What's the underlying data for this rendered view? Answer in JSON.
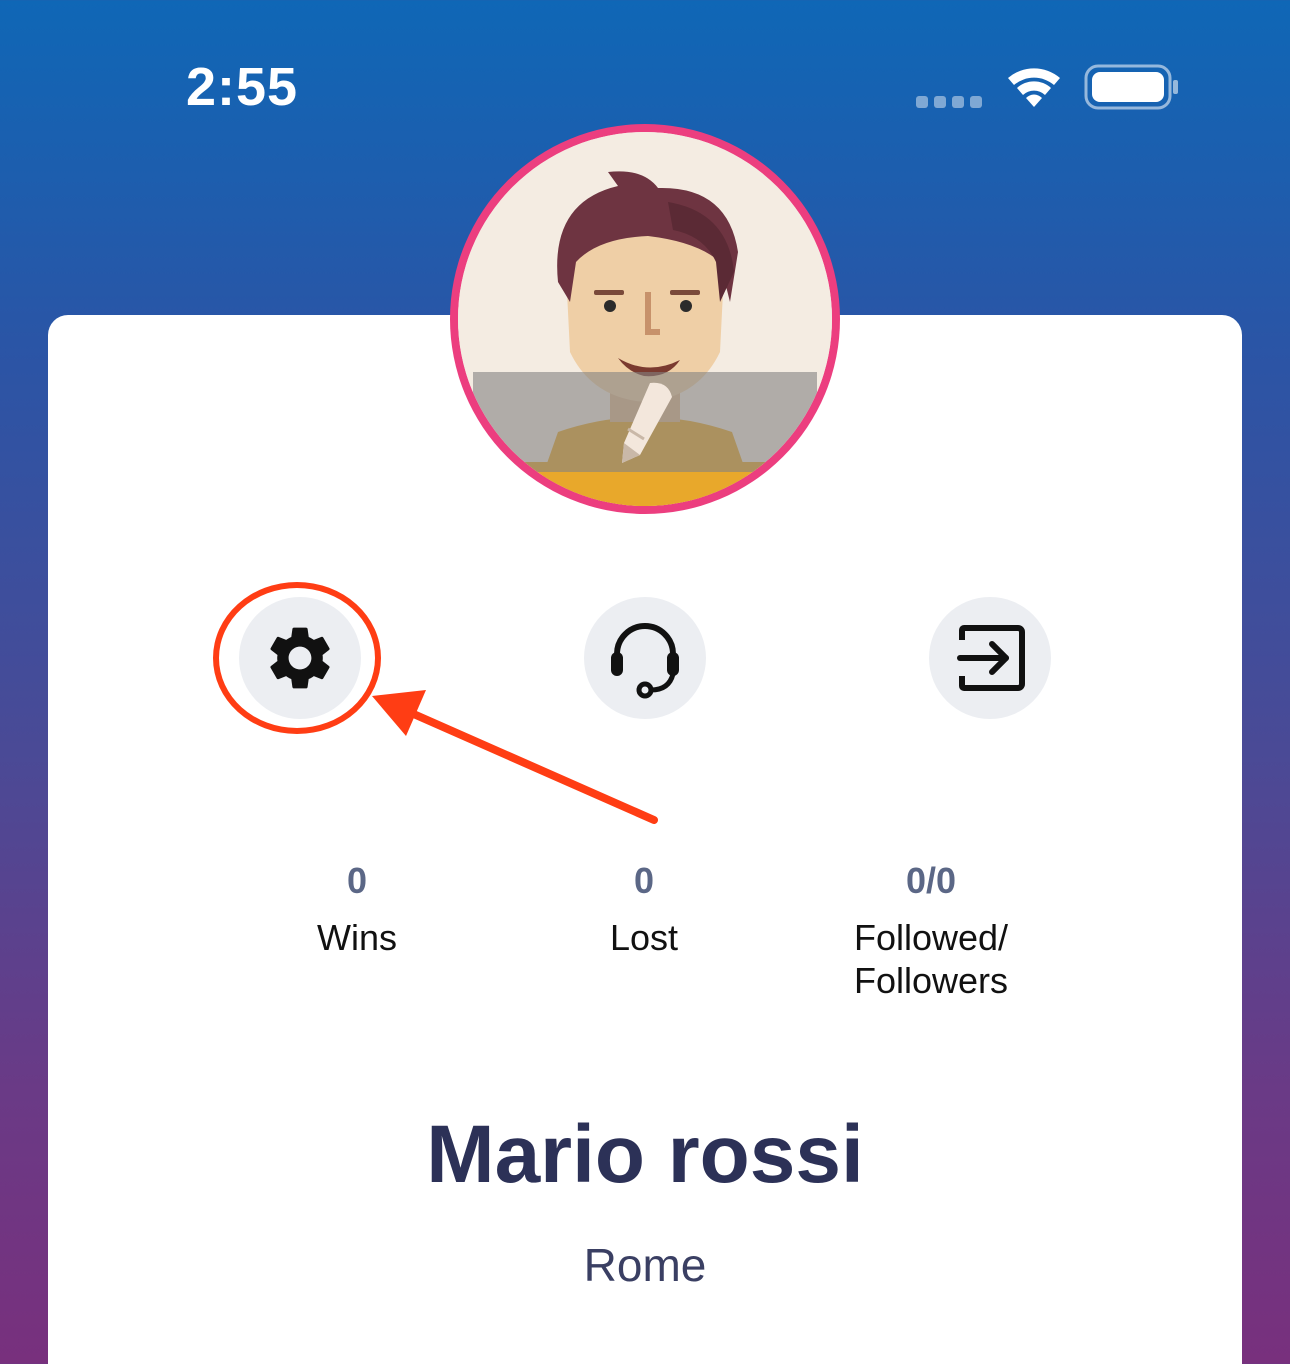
{
  "status_bar": {
    "time": "2:55"
  },
  "profile": {
    "name": "Mario rossi",
    "city": "Rome",
    "avatar_ring_color": "#ec3e7f",
    "edit_icon": "pencil-icon"
  },
  "actions": [
    {
      "name": "settings",
      "icon": "gear-icon"
    },
    {
      "name": "support",
      "icon": "headset-icon"
    },
    {
      "name": "logout",
      "icon": "exit-icon"
    }
  ],
  "stats": {
    "wins": {
      "value": "0",
      "label": "Wins"
    },
    "lost": {
      "value": "0",
      "label": "Lost"
    },
    "follow": {
      "value": "0/0",
      "label_line1": "Followed/",
      "label_line2": "Followers"
    }
  },
  "annotation": {
    "highlight_color": "#ff3d14",
    "target": "settings"
  }
}
